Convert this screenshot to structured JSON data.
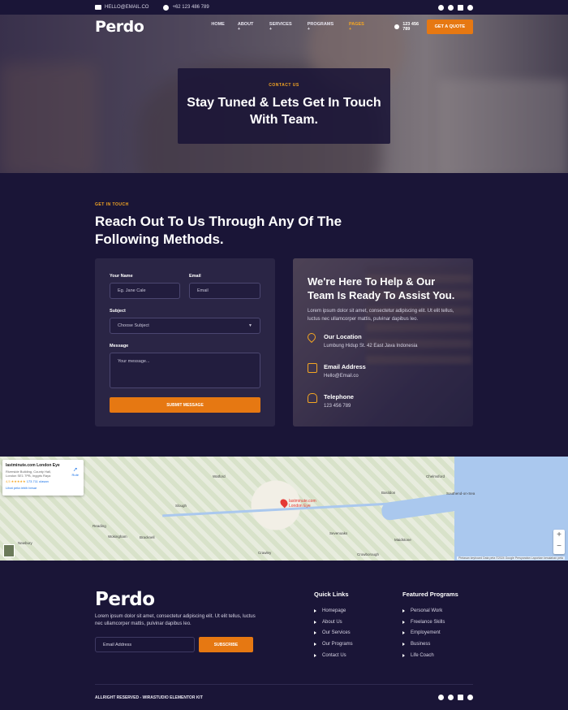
{
  "topbar": {
    "email": "HELLO@EMAIL.CO",
    "phone": "+62 123 486 789",
    "social": [
      "facebook-icon",
      "twitter-icon",
      "youtube-icon",
      "pinterest-icon"
    ]
  },
  "nav": {
    "logo": "Perdo",
    "items": [
      {
        "label": "HOME"
      },
      {
        "label": "ABOUT +"
      },
      {
        "label": "SERVICES +"
      },
      {
        "label": "PROGRAMS +"
      },
      {
        "label": "PAGES +"
      }
    ],
    "phone": "123 456 789",
    "cta": "GET A QUOTE"
  },
  "hero": {
    "kicker": "CONTACT US",
    "title": "Stay Tuned & Lets Get In Touch With Team."
  },
  "contact": {
    "kicker": "GET IN TOUCH",
    "title": "Reach Out To Us Through Any Of The Following Methods.",
    "form": {
      "name_label": "Your Name",
      "name_placeholder": "Eg. Jane Cale",
      "email_label": "Email",
      "email_placeholder": "Email",
      "subject_label": "Subject",
      "subject_value": "Choose Subject",
      "message_label": "Message",
      "message_placeholder": "Your message...",
      "submit": "SUBMIT MESSAGE"
    },
    "info": {
      "title": "We're Here To Help & Our Team Is Ready To Assist You.",
      "text": "Lorem ipsum dolor sit amet, consectetur adipiscing elit. Ut elit tellus, luctus nec ullamcorper mattis, pulvinar dapibus leo.",
      "items": [
        {
          "title": "Our Location",
          "value": "Lumbung Hidup St. 42 East Java Indonesia"
        },
        {
          "title": "Email Address",
          "value": "Hello@Email.co"
        },
        {
          "title": "Telephone",
          "value": "123 456 789"
        }
      ]
    }
  },
  "map": {
    "place_name": "lastminute.com London Eye",
    "address": "Riverside Building, County Hall, London SE1 7PB, Inggris Raya",
    "rating": "4,5 ★★★★★",
    "reviews": "173.711 ulasan",
    "route": "Rute",
    "larger_map": "Lihat peta lebih besar",
    "pin_label": "lastminute.com London Eye",
    "labels": [
      "Watford",
      "Slough",
      "Reading",
      "Wokingham",
      "Bracknell",
      "Crawley",
      "Chelmsford",
      "Basildon",
      "Southend-on-Sea",
      "Sevenoaks",
      "Maidstone",
      "Crowborough",
      "Newbury"
    ],
    "attribution": "Pintasan keyboard   Data peta ©2024 Google   Persyaratan   Laporkan kesalahan peta"
  },
  "footer": {
    "logo": "Perdo",
    "text": "Lorem ipsum dolor sit amet, consectetur adipiscing elit. Ut elit tellus, luctus nec ullamcorper mattis, pulvinar dapibus leo.",
    "email_placeholder": "Email Address",
    "subscribe": "SUBSCRIBE",
    "quick_links": {
      "title": "Quick Links",
      "items": [
        "Homepage",
        "About Us",
        "Our Services",
        "Our Programs",
        "Contact Us"
      ]
    },
    "featured": {
      "title": "Featured Programs",
      "items": [
        "Personal Work",
        "Freelance Skills",
        "Employement",
        "Business",
        "Life Coach"
      ]
    },
    "copyright": "ALLRIGHT RESERVED - WIRASTUDIO ELEMENTOR KIT"
  },
  "colors": {
    "background": "#1a1537",
    "card": "#2a2545",
    "accent": "#e67812",
    "highlight": "#f5a623"
  }
}
